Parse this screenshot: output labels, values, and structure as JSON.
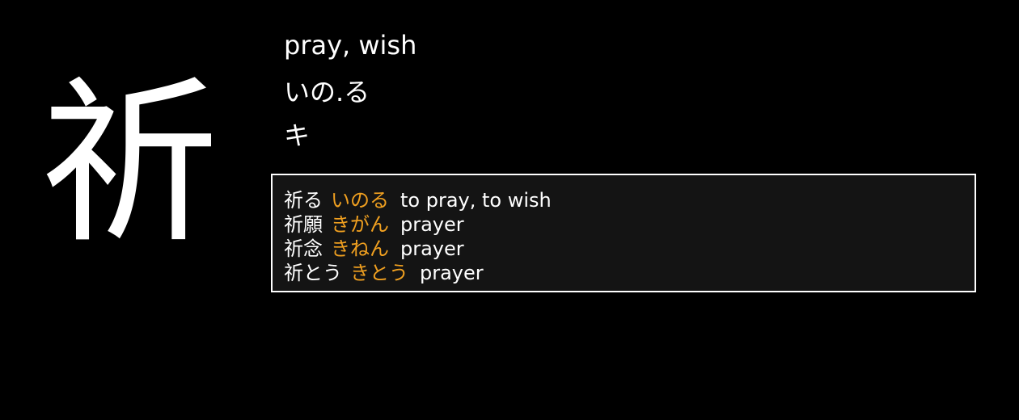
{
  "kanji": {
    "character": "祈",
    "meaning": "pray, wish",
    "kun_reading": "いの.る",
    "on_reading": "キ"
  },
  "colors": {
    "background": "#000000",
    "text": "#ffffff",
    "reading_accent": "#f0a020",
    "vocab_panel_bg": "#141414",
    "vocab_panel_border": "#ffffff"
  },
  "vocab": [
    {
      "word": "祈る",
      "reading": "いのる",
      "gloss": "to pray, to wish"
    },
    {
      "word": "祈願",
      "reading": "きがん",
      "gloss": "prayer"
    },
    {
      "word": "祈念",
      "reading": "きねん",
      "gloss": "prayer"
    },
    {
      "word": "祈とう",
      "reading": "きとう",
      "gloss": "prayer"
    }
  ]
}
